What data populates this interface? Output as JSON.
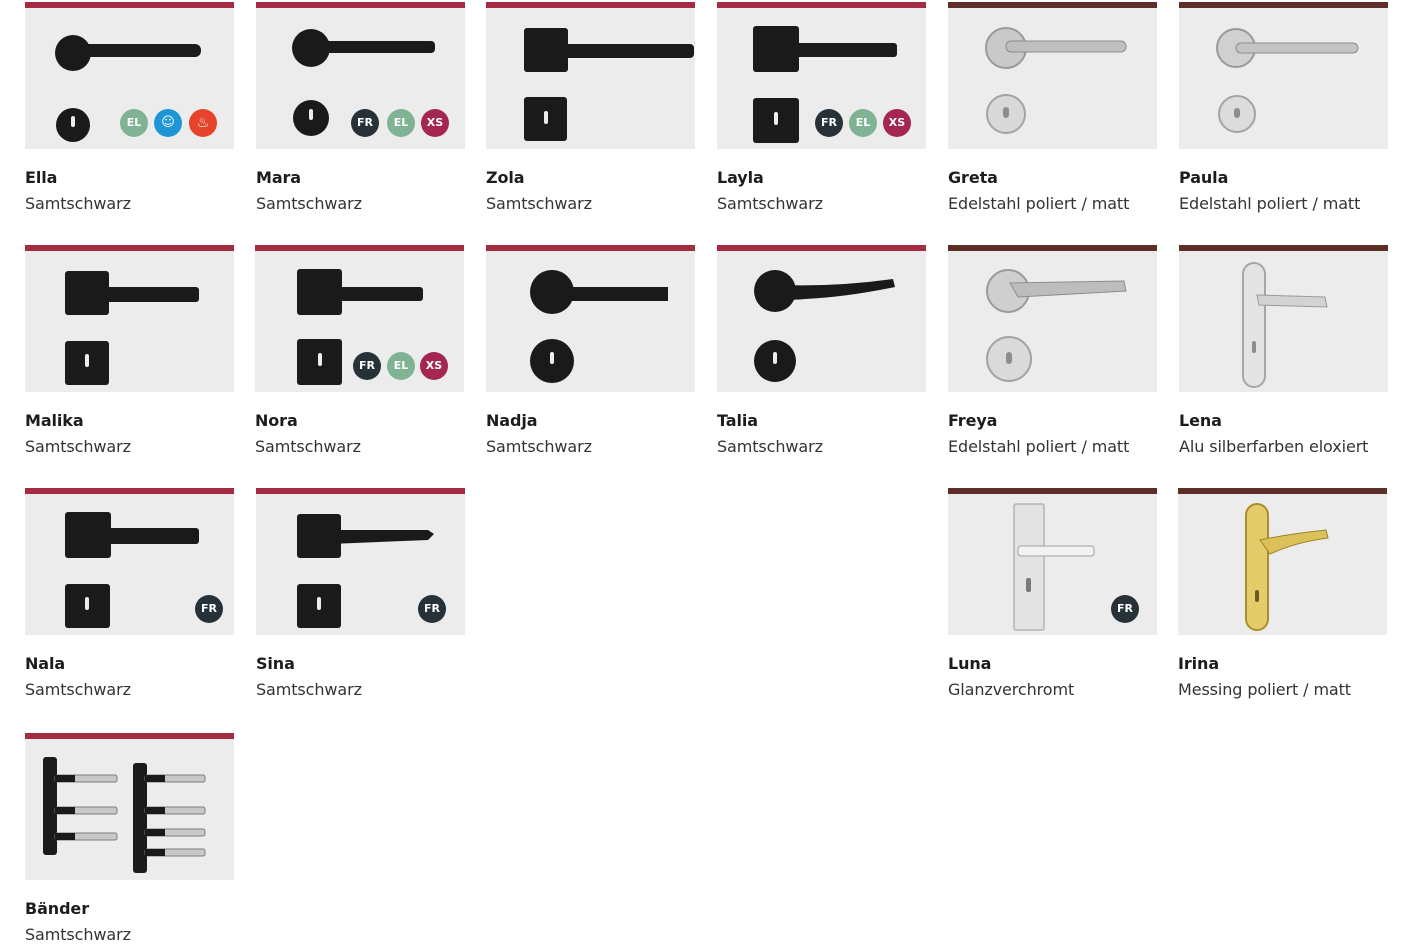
{
  "colors": {
    "accent_red": "#a32b42",
    "accent_brown": "#5e2e29",
    "tile_bg": "#ececec"
  },
  "products": [
    {
      "name": "Ella",
      "finish": "Samtschwarz",
      "badges": [
        "EL",
        "kid",
        "fire"
      ]
    },
    {
      "name": "Mara",
      "finish": "Samtschwarz",
      "badges": [
        "FR",
        "EL",
        "XS"
      ]
    },
    {
      "name": "Zola",
      "finish": "Samtschwarz",
      "badges": []
    },
    {
      "name": "Layla",
      "finish": "Samtschwarz",
      "badges": [
        "FR",
        "EL",
        "XS"
      ]
    },
    {
      "name": "Greta",
      "finish": "Edelstahl poliert / matt",
      "badges": []
    },
    {
      "name": "Paula",
      "finish": "Edelstahl poliert / matt",
      "badges": []
    },
    {
      "name": "Malika",
      "finish": "Samtschwarz",
      "badges": []
    },
    {
      "name": "Nora",
      "finish": "Samtschwarz",
      "badges": [
        "FR",
        "EL",
        "XS"
      ]
    },
    {
      "name": "Nadja",
      "finish": "Samtschwarz",
      "badges": []
    },
    {
      "name": "Talia",
      "finish": "Samtschwarz",
      "badges": []
    },
    {
      "name": "Freya",
      "finish": "Edelstahl poliert / matt",
      "badges": []
    },
    {
      "name": "Lena",
      "finish": "Alu silberfarben eloxiert",
      "badges": []
    },
    {
      "name": "Nala",
      "finish": "Samtschwarz",
      "badges": [
        "FR"
      ]
    },
    {
      "name": "Sina",
      "finish": "Samtschwarz",
      "badges": [
        "FR"
      ]
    },
    {
      "name": "Luna",
      "finish": "Glanzverchromt",
      "badges": [
        "FR"
      ]
    },
    {
      "name": "Irina",
      "finish": "Messing poliert / matt",
      "badges": []
    },
    {
      "name": "Bänder",
      "finish": "Samtschwarz",
      "badges": []
    }
  ]
}
